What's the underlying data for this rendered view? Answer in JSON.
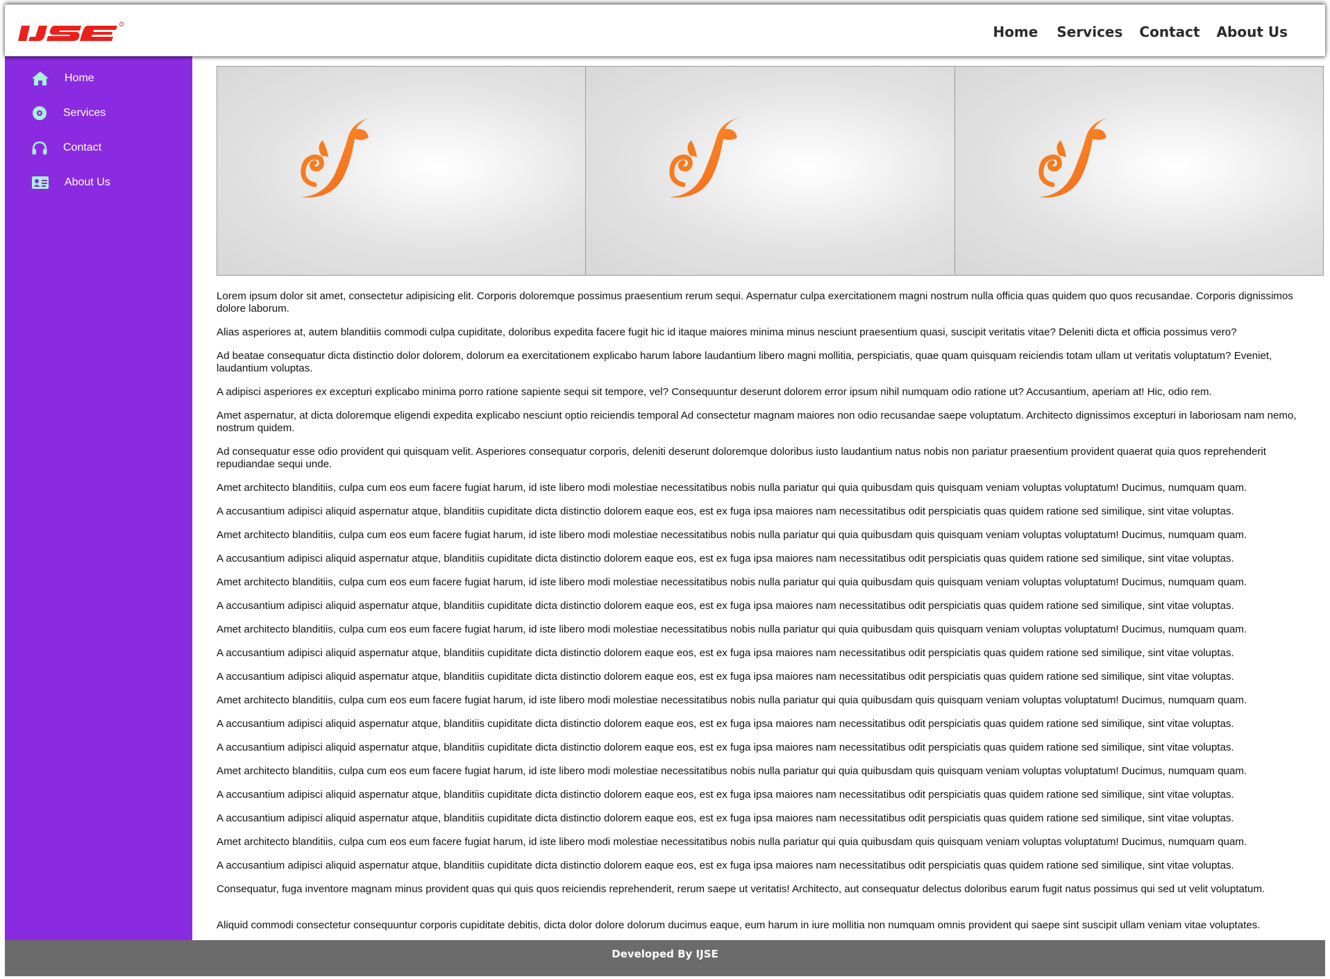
{
  "brand": {
    "logo_text": "IJSE"
  },
  "topnav": {
    "items": [
      "Home",
      "Services",
      "Contact",
      "About Us"
    ]
  },
  "sidebar": {
    "items": [
      {
        "label": "Home",
        "icon": "home-icon"
      },
      {
        "label": "Services",
        "icon": "disc-icon"
      },
      {
        "label": "Contact",
        "icon": "headphones-icon"
      },
      {
        "label": "About Us",
        "icon": "id-card-icon"
      }
    ]
  },
  "gallery": {
    "images": [
      "squirrel-logo-image",
      "squirrel-logo-image",
      "squirrel-logo-image"
    ]
  },
  "paragraphs": [
    "Lorem ipsum dolor sit amet, consectetur adipisicing elit. Corporis doloremque possimus praesentium rerum sequi. Aspernatur culpa exercitationem magni nostrum nulla officia quas quidem quo quos recusandae. Corporis dignissimos dolore laborum.",
    "Alias asperiores at, autem blanditiis commodi culpa cupiditate, doloribus expedita facere fugit hic id itaque maiores minima minus nesciunt praesentium quasi, suscipit veritatis vitae? Deleniti dicta et officia possimus vero?",
    "Ad beatae consequatur dicta distinctio dolor dolorem, dolorum ea exercitationem explicabo harum labore laudantium libero magni mollitia, perspiciatis, quae quam quisquam reiciendis totam ullam ut veritatis voluptatum? Eveniet, laudantium voluptas.",
    "A adipisci asperiores ex excepturi explicabo minima porro ratione sapiente sequi sit tempore, vel? Consequuntur deserunt dolorem error ipsum nihil numquam odio ratione ut? Accusantium, aperiam at! Hic, odio rem.",
    "Amet aspernatur, at dicta doloremque eligendi expedita explicabo nesciunt optio reiciendis temporal Ad consectetur magnam maiores non odio recusandae saepe voluptatum. Architecto dignissimos excepturi in laboriosam nam nemo, nostrum quidem.",
    "Ad consequatur esse odio provident qui quisquam velit. Asperiores consequatur corporis, deleniti deserunt doloremque doloribus iusto laudantium natus nobis non pariatur praesentium provident quaerat quia quos reprehenderit repudiandae sequi unde.",
    "Amet architecto blanditiis, culpa cum eos eum facere fugiat harum, id iste libero modi molestiae necessitatibus nobis nulla pariatur qui quia quibusdam quis quisquam veniam voluptas voluptatum! Ducimus, numquam quam.",
    "A accusantium adipisci aliquid aspernatur atque, blanditiis cupiditate dicta distinctio dolorem eaque eos, est ex fuga ipsa maiores nam necessitatibus odit perspiciatis quas quidem ratione sed similique, sint vitae voluptas.",
    "Amet architecto blanditiis, culpa cum eos eum facere fugiat harum, id iste libero modi molestiae necessitatibus nobis nulla pariatur qui quia quibusdam quis quisquam veniam voluptas voluptatum! Ducimus, numquam quam.",
    "A accusantium adipisci aliquid aspernatur atque, blanditiis cupiditate dicta distinctio dolorem eaque eos, est ex fuga ipsa maiores nam necessitatibus odit perspiciatis quas quidem ratione sed similique, sint vitae voluptas.",
    "Amet architecto blanditiis, culpa cum eos eum facere fugiat harum, id iste libero modi molestiae necessitatibus nobis nulla pariatur qui quia quibusdam quis quisquam veniam voluptas voluptatum! Ducimus, numquam quam.",
    "A accusantium adipisci aliquid aspernatur atque, blanditiis cupiditate dicta distinctio dolorem eaque eos, est ex fuga ipsa maiores nam necessitatibus odit perspiciatis quas quidem ratione sed similique, sint vitae voluptas.",
    "Amet architecto blanditiis, culpa cum eos eum facere fugiat harum, id iste libero modi molestiae necessitatibus nobis nulla pariatur qui quia quibusdam quis quisquam veniam voluptas voluptatum! Ducimus, numquam quam.",
    "A accusantium adipisci aliquid aspernatur atque, blanditiis cupiditate dicta distinctio dolorem eaque eos, est ex fuga ipsa maiores nam necessitatibus odit perspiciatis quas quidem ratione sed similique, sint vitae voluptas.",
    "A accusantium adipisci aliquid aspernatur atque, blanditiis cupiditate dicta distinctio dolorem eaque eos, est ex fuga ipsa maiores nam necessitatibus odit perspiciatis quas quidem ratione sed similique, sint vitae voluptas.",
    "Amet architecto blanditiis, culpa cum eos eum facere fugiat harum, id iste libero modi molestiae necessitatibus nobis nulla pariatur qui quia quibusdam quis quisquam veniam voluptas voluptatum! Ducimus, numquam quam.",
    "A accusantium adipisci aliquid aspernatur atque, blanditiis cupiditate dicta distinctio dolorem eaque eos, est ex fuga ipsa maiores nam necessitatibus odit perspiciatis quas quidem ratione sed similique, sint vitae voluptas.",
    "A accusantium adipisci aliquid aspernatur atque, blanditiis cupiditate dicta distinctio dolorem eaque eos, est ex fuga ipsa maiores nam necessitatibus odit perspiciatis quas quidem ratione sed similique, sint vitae voluptas.",
    "Amet architecto blanditiis, culpa cum eos eum facere fugiat harum, id iste libero modi molestiae necessitatibus nobis nulla pariatur qui quia quibusdam quis quisquam veniam voluptas voluptatum! Ducimus, numquam quam.",
    "A accusantium adipisci aliquid aspernatur atque, blanditiis cupiditate dicta distinctio dolorem eaque eos, est ex fuga ipsa maiores nam necessitatibus odit perspiciatis quas quidem ratione sed similique, sint vitae voluptas.",
    "A accusantium adipisci aliquid aspernatur atque, blanditiis cupiditate dicta distinctio dolorem eaque eos, est ex fuga ipsa maiores nam necessitatibus odit perspiciatis quas quidem ratione sed similique, sint vitae voluptas.",
    "Amet architecto blanditiis, culpa cum eos eum facere fugiat harum, id iste libero modi molestiae necessitatibus nobis nulla pariatur qui quia quibusdam quis quisquam veniam voluptas voluptatum! Ducimus, numquam quam.",
    "A accusantium adipisci aliquid aspernatur atque, blanditiis cupiditate dicta distinctio dolorem eaque eos, est ex fuga ipsa maiores nam necessitatibus odit perspiciatis quas quidem ratione sed similique, sint vitae voluptas.",
    "Consequatur, fuga inventore magnam minus provident quas qui quis quos reiciendis reprehenderit, rerum saepe ut veritatis! Architecto, aut consequatur delectus doloribus earum fugit natus possimus qui sed ut velit voluptatum.",
    "Aliquid commodi consectetur consequuntur corporis cupiditate debitis, dicta dolor dolore dolorum ducimus eaque, eum harum in iure mollitia non numquam omnis provident qui saepe sint suscipit ullam veniam vitae voluptates."
  ],
  "footer": {
    "text": "Developed By IJSE"
  },
  "colors": {
    "sidebar": "#8a2be2",
    "footer": "#6b6b6b",
    "logo": "#e8221b",
    "accent_orange": "#f57c1f",
    "sidebar_icon": "#a8f0dc"
  }
}
